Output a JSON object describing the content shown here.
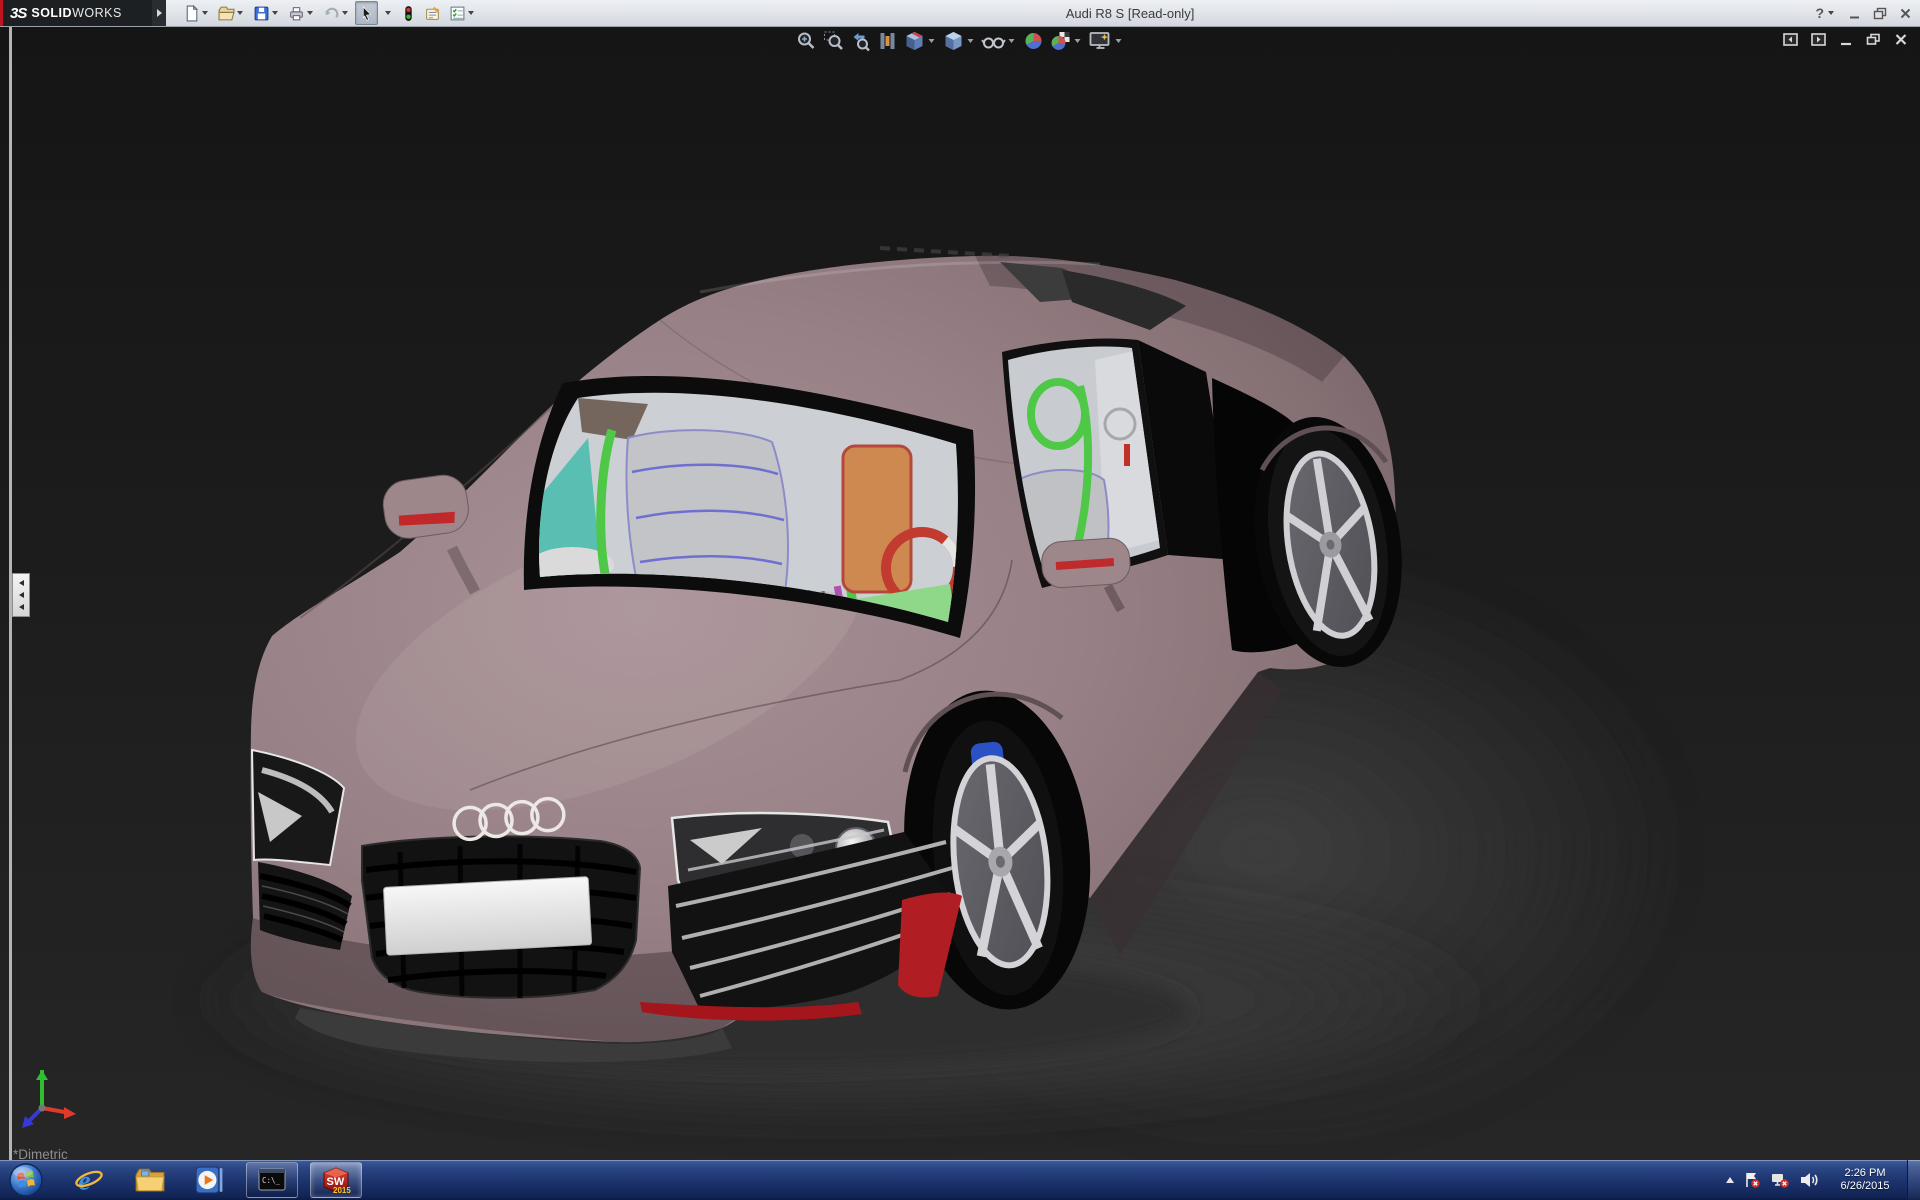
{
  "titlebar": {
    "brand": {
      "logo": "3S",
      "name_bold": "SOLID",
      "name_light": "WORKS"
    },
    "title": "Audi R8 S [Read-only]",
    "help_glyph": "?",
    "toolbar_icons": [
      "new-document",
      "open",
      "save",
      "print",
      "undo",
      "select",
      "display-states",
      "comment",
      "options"
    ],
    "window_controls": [
      "help",
      "minimize",
      "restore",
      "close"
    ]
  },
  "viewport": {
    "headsup_icons": [
      "zoom-to-fit",
      "zoom-to-area",
      "previous-view",
      "section-view",
      "view-orientation",
      "display-style",
      "hide-show-items",
      "edit-appearance",
      "apply-scene",
      "view-settings"
    ],
    "document_controls": [
      "collapse-pane-left",
      "collapse-pane-right",
      "minimize",
      "restore",
      "close"
    ],
    "orientation_label": "*Dimetric",
    "triad_axis_colors": {
      "x_red": "#e03a2a",
      "y_green": "#2fbf2f",
      "z_blue": "#3838d8"
    },
    "background_top": "#151515",
    "background_bottom": "#262626"
  },
  "model": {
    "body_color": "#9a8387",
    "accent_red": "#b01d22",
    "rollcage_green": "#4fc848",
    "seat_gray": "#bfc1c5",
    "seatback_orange": "#cd8950",
    "dash_teal": "#58bfb2",
    "rim_silver": "#d4d4d8",
    "caliper_blue": "#2a52c4",
    "license_plate": "#eeeeee"
  },
  "taskbar": {
    "pinned": [
      "start",
      "internet-explorer",
      "windows-explorer",
      "media-player",
      "command-prompt",
      "solidworks-2015"
    ],
    "command_prompt_text": "C:\\_",
    "solidworks_icon": {
      "letters": "SW",
      "year": "2015"
    },
    "tray_icons": [
      "show-hidden-icons",
      "action-center",
      "network-error",
      "volume"
    ],
    "clock": {
      "time": "2:26 PM",
      "date": "6/26/2015"
    }
  }
}
